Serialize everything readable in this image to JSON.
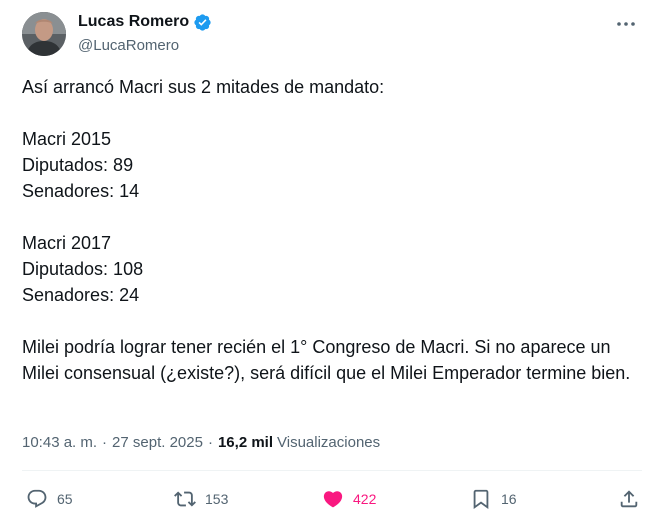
{
  "author": {
    "name": "Lucas Romero",
    "handle": "@LucaRomero",
    "verified": true
  },
  "tweet": {
    "text": "Así arrancó Macri sus 2 mitades de mandato:\n\nMacri 2015\nDiputados: 89\nSenadores: 14\n\nMacri 2017\nDiputados: 108\nSenadores: 24\n\nMilei podría lograr tener recién el 1° Congreso de Macri. Si no aparece un Milei consensual (¿existe?), será difícil que el Milei Emperador termine bien."
  },
  "meta": {
    "time": "10:43 a. m.",
    "separator": "·",
    "date": "27 sept. 2025",
    "views_count": "16,2 mil",
    "views_label": "Visualizaciones"
  },
  "actions": {
    "replies": "65",
    "reposts": "153",
    "likes": "422",
    "bookmarks": "16"
  },
  "colors": {
    "text": "#0f1419",
    "secondary": "#536471",
    "verified": "#1d9bf0",
    "like": "#f91880"
  },
  "icons": [
    "more-icon",
    "verified-badge-icon",
    "reply-icon",
    "repost-icon",
    "like-icon",
    "bookmark-icon",
    "share-icon"
  ]
}
